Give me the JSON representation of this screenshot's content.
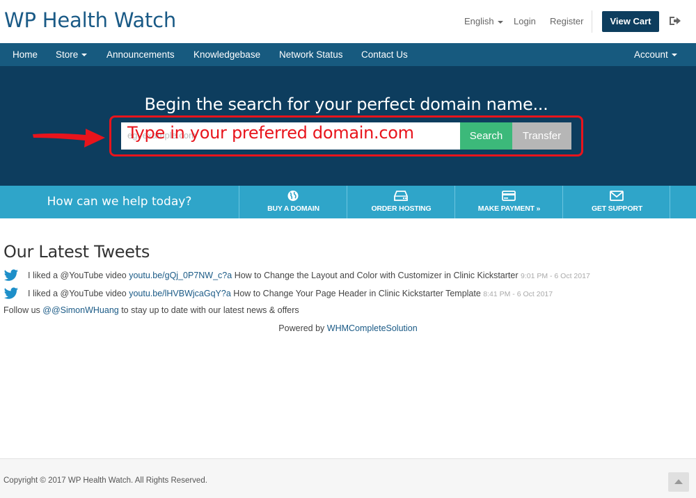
{
  "header": {
    "logo": "WP Health Watch",
    "language": "English",
    "login": "Login",
    "register": "Register",
    "view_cart": "View Cart"
  },
  "nav": {
    "home": "Home",
    "store": "Store",
    "announcements": "Announcements",
    "knowledgebase": "Knowledgebase",
    "network_status": "Network Status",
    "contact_us": "Contact Us",
    "account": "Account"
  },
  "hero": {
    "title": "Begin the search for your perfect domain name...",
    "placeholder": "eg. example.com",
    "overlay": "Type in your preferred domain.com",
    "search_label": "Search",
    "transfer_label": "Transfer"
  },
  "help": {
    "prompt": "How can we help today?",
    "items": [
      {
        "label": "BUY A DOMAIN",
        "icon": "globe-icon"
      },
      {
        "label": "ORDER HOSTING",
        "icon": "server-icon"
      },
      {
        "label": "MAKE PAYMENT »",
        "icon": "credit-card-icon"
      },
      {
        "label": "GET SUPPORT",
        "icon": "envelope-icon"
      }
    ]
  },
  "tweets": {
    "title": "Our Latest Tweets",
    "items": [
      {
        "prefix": "I liked a @YouTube video ",
        "link": "youtu.be/gQj_0P7NW_c?a",
        "suffix": " How to Change the Layout and Color with Customizer in Clinic Kickstarter ",
        "time": "9:01 PM - 6 Oct 2017"
      },
      {
        "prefix": "I liked a @YouTube video ",
        "link": "youtu.be/lHVBWjcaGqY?a",
        "suffix": " How to Change Your Page Header in Clinic Kickstarter Template ",
        "time": "8:41 PM - 6 Oct 2017"
      }
    ],
    "follow_prefix": "Follow us ",
    "follow_handle": "@@SimonWHuang",
    "follow_suffix": " to stay up to date with our latest news & offers"
  },
  "powered": {
    "prefix": "Powered by ",
    "link": "WHMCompleteSolution"
  },
  "footer": {
    "copyright": "Copyright © 2017 WP Health Watch. All Rights Reserved."
  },
  "colors": {
    "brand_dark": "#0d3d5e",
    "nav": "#175a7f",
    "help_bar": "#2fa5c9",
    "search_green": "#3cb97a",
    "highlight_red": "#e8141c"
  }
}
